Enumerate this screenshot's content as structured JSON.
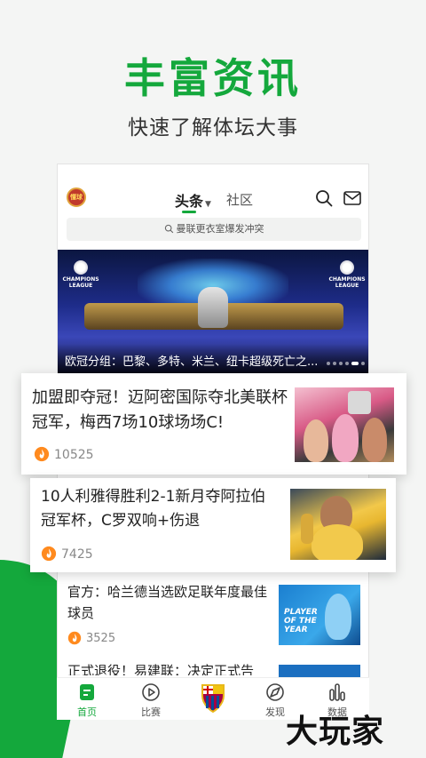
{
  "promo": {
    "headline": "丰富资讯",
    "subheadline": "快速了解体坛大事"
  },
  "app": {
    "logo_text": "懂球",
    "tabs": [
      {
        "label": "头条",
        "active": true
      },
      {
        "label": "社区",
        "active": false
      }
    ],
    "search_placeholder": "曼联更衣室爆发冲突",
    "banner": {
      "caption": "欧冠分组：巴黎、多特、米兰、纽卡超级死亡之...",
      "logo_text_left": "CHAMPIONS LEAGUE",
      "logo_text_right": "CHAMPIONS LEAGUE"
    },
    "news": [
      {
        "title": "加盟即夺冠！迈阿密国际夺北美联杯冠军，梅西7场10球场场C!",
        "count": "10525"
      },
      {
        "title": "10人利雅得胜利2-1新月夺阿拉伯冠军杯，C罗双响+伤退",
        "count": "7425"
      },
      {
        "title": "官方：哈兰德当选欧足联年度最佳球员",
        "count": "3525",
        "thumb_text": "PLAYER OF THE YEAR"
      },
      {
        "title": "正式退役！易建联：决定正式告"
      }
    ],
    "bottom_nav": [
      {
        "label": "首页",
        "icon": "home-icon",
        "active": true
      },
      {
        "label": "比赛",
        "icon": "play-icon",
        "active": false
      },
      {
        "label": "",
        "icon": "barca-crest-icon",
        "active": false
      },
      {
        "label": "发现",
        "icon": "discover-icon",
        "active": false
      },
      {
        "label": "数据",
        "icon": "data-icon",
        "active": false
      }
    ]
  },
  "watermark": "大玩家",
  "colors": {
    "brand_green": "#14a83c",
    "fire_orange": "#ff8a1e"
  }
}
